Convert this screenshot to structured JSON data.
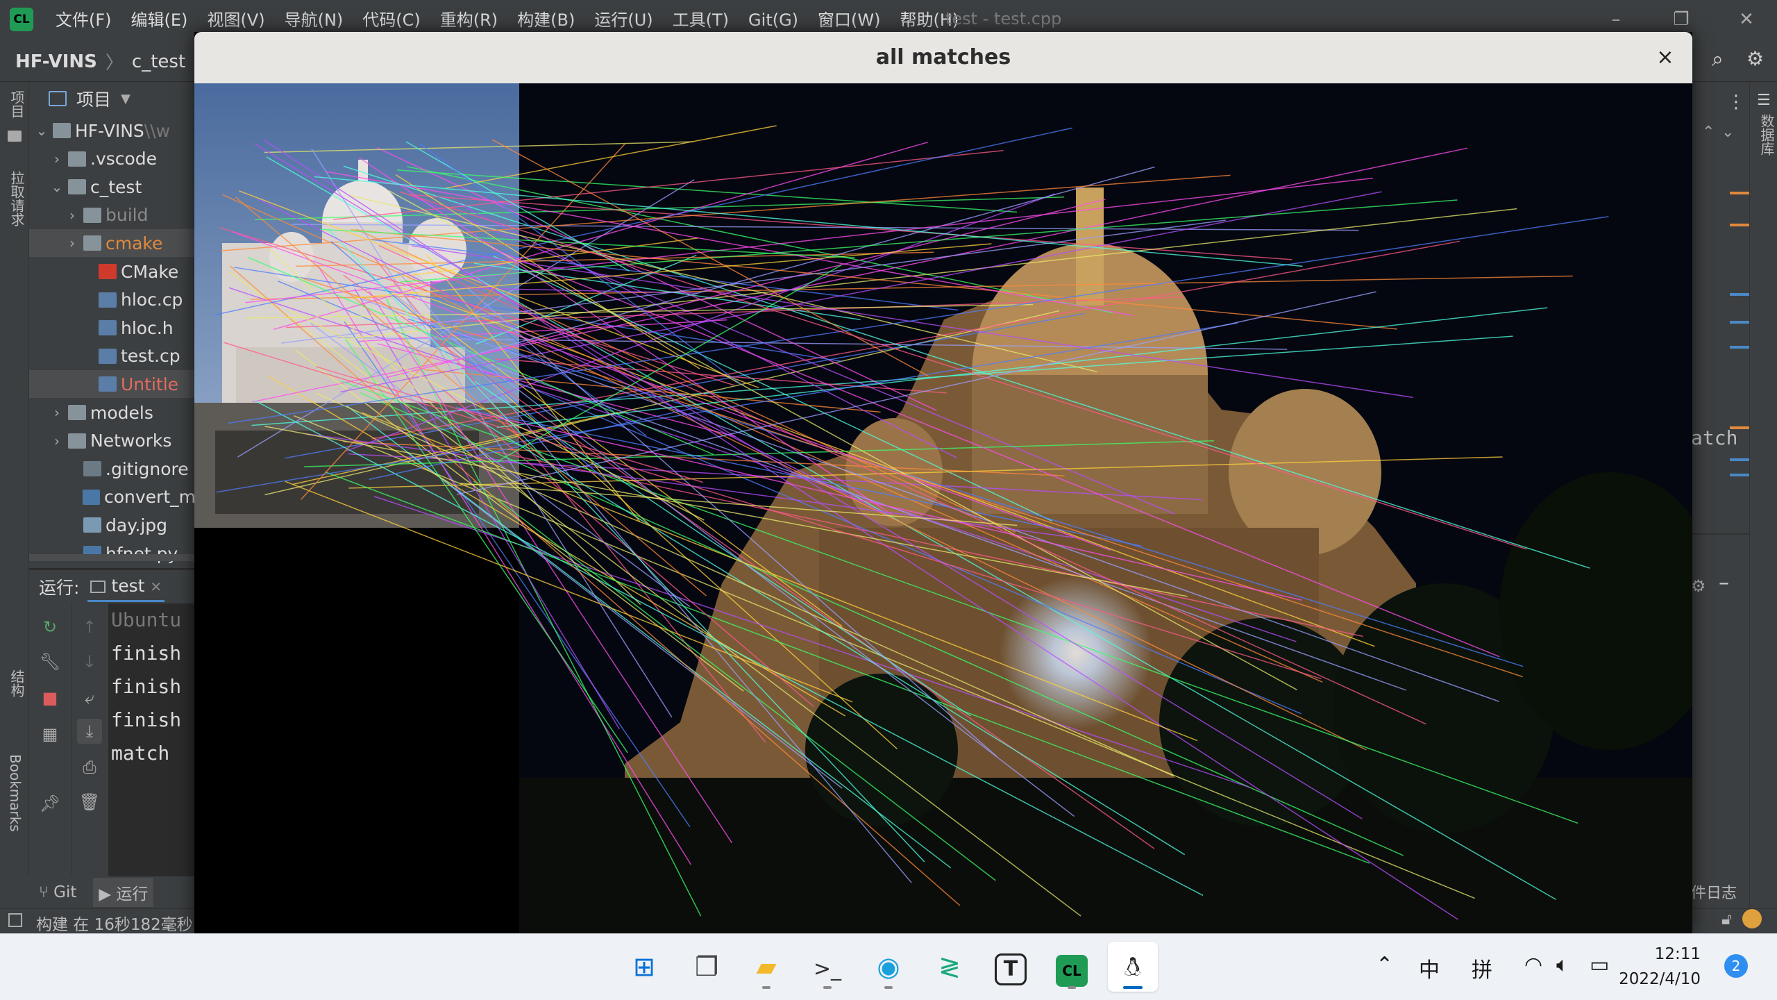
{
  "ide": {
    "logo": "CL",
    "menu": [
      "文件(F)",
      "编辑(E)",
      "视图(V)",
      "导航(N)",
      "代码(C)",
      "重构(R)",
      "构建(B)",
      "运行(U)",
      "工具(T)",
      "Git(G)",
      "窗口(W)",
      "帮助(H)"
    ],
    "window_title": "test - test.cpp",
    "breadcrumb": [
      "HF-VINS",
      "c_test"
    ],
    "left_tool_labels": [
      "项目",
      "拉取请求",
      "结构",
      "Bookmarks"
    ],
    "right_tool_label": "数据库",
    "right_fragment": "atch",
    "right_bottom_label": "件日志"
  },
  "project": {
    "header": "项目",
    "items": [
      {
        "label": "HF-VINS",
        "suffix": "\\\\w",
        "depth": 0,
        "expanded": true,
        "icon": "folder-icon",
        "style": "normal"
      },
      {
        "label": ".vscode",
        "depth": 1,
        "expanded": false,
        "icon": "folder-icon",
        "style": "normal"
      },
      {
        "label": "c_test",
        "depth": 1,
        "expanded": true,
        "icon": "folder-icon",
        "style": "normal"
      },
      {
        "label": "build",
        "depth": 2,
        "expanded": false,
        "icon": "folder-icon",
        "style": "grey"
      },
      {
        "label": "cmake",
        "depth": 2,
        "expanded": false,
        "icon": "folder-icon",
        "style": "orange"
      },
      {
        "label": "CMake",
        "depth": 3,
        "icon": "cmake-file-icon",
        "style": "normal"
      },
      {
        "label": "hloc.cp",
        "depth": 3,
        "icon": "cpp-file-icon",
        "style": "normal"
      },
      {
        "label": "hloc.h",
        "depth": 3,
        "icon": "h-file-icon",
        "style": "normal"
      },
      {
        "label": "test.cp",
        "depth": 3,
        "icon": "cpp-file-icon",
        "style": "normal"
      },
      {
        "label": "Untitle",
        "depth": 3,
        "icon": "cpp-file-icon",
        "style": "red"
      },
      {
        "label": "models",
        "depth": 1,
        "expanded": false,
        "icon": "folder-icon",
        "style": "normal"
      },
      {
        "label": "Networks",
        "depth": 1,
        "expanded": false,
        "icon": "folder-icon",
        "style": "normal"
      },
      {
        "label": ".gitignore",
        "depth": 2,
        "icon": "git-file-icon",
        "style": "normal"
      },
      {
        "label": "convert_m",
        "depth": 2,
        "icon": "py-file-icon",
        "style": "normal"
      },
      {
        "label": "day.jpg",
        "depth": 2,
        "icon": "image-file-icon",
        "style": "normal"
      },
      {
        "label": "hfnet.py",
        "depth": 2,
        "icon": "py-file-icon",
        "style": "normal"
      }
    ]
  },
  "run": {
    "label": "运行:",
    "tab": "test",
    "console_lines": [
      "Ubuntu",
      "finish",
      "finish",
      "finish",
      "match"
    ]
  },
  "bottom_tabs": [
    "Git",
    "运行"
  ],
  "status": {
    "text": "构建 在 16秒182毫秒"
  },
  "dialog": {
    "title": "all matches",
    "close": "×"
  },
  "taskbar": {
    "apps": [
      "start-icon",
      "task-view-icon",
      "file-explorer-icon",
      "terminal-icon",
      "edge-icon",
      "vscode-icon",
      "typora-icon",
      "clion-icon",
      "wsl-linux-icon"
    ],
    "typora_glyph": "T",
    "clion_glyph": "CL",
    "tray": {
      "ime1": "中",
      "ime2": "拼"
    },
    "time": "12:11",
    "date": "2022/4/10",
    "notifications": "2"
  },
  "colors": {
    "ide_bg": "#2b2b2b",
    "panel_bg": "#3c3f41",
    "accent": "#4a88c7",
    "dialog_title_bg": "#e8e6e3",
    "taskbar_bg": "#eef1f5"
  }
}
